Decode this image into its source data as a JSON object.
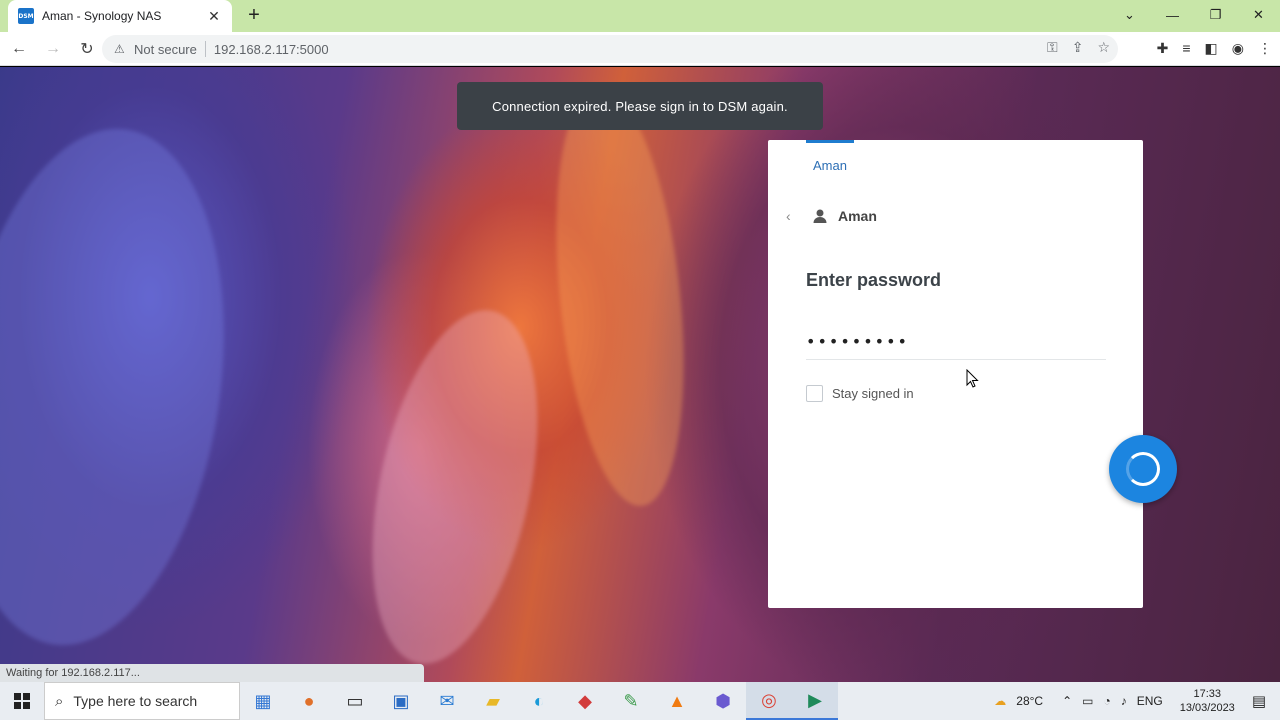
{
  "browser": {
    "tab_title": "Aman - Synology NAS",
    "favicon_text": "DSM",
    "new_tab": "+",
    "security_label": "Not secure",
    "url": "192.168.2.117:5000",
    "status_text": "Waiting for 192.168.2.117..."
  },
  "page": {
    "toast": "Connection expired. Please sign in to DSM again.",
    "user_tab": "Aman",
    "user_name": "Aman",
    "heading": "Enter password",
    "password_value": "•••••••••",
    "stay_signed_in": "Stay signed in"
  },
  "taskbar": {
    "search_placeholder": "Type here to search",
    "weather": "28°C",
    "language": "ENG",
    "time": "17:33",
    "date": "13/03/2023"
  },
  "colors": {
    "accent": "#1c85e0",
    "tab_strip": "#c8e6a8",
    "toast_bg": "#3b4147"
  }
}
